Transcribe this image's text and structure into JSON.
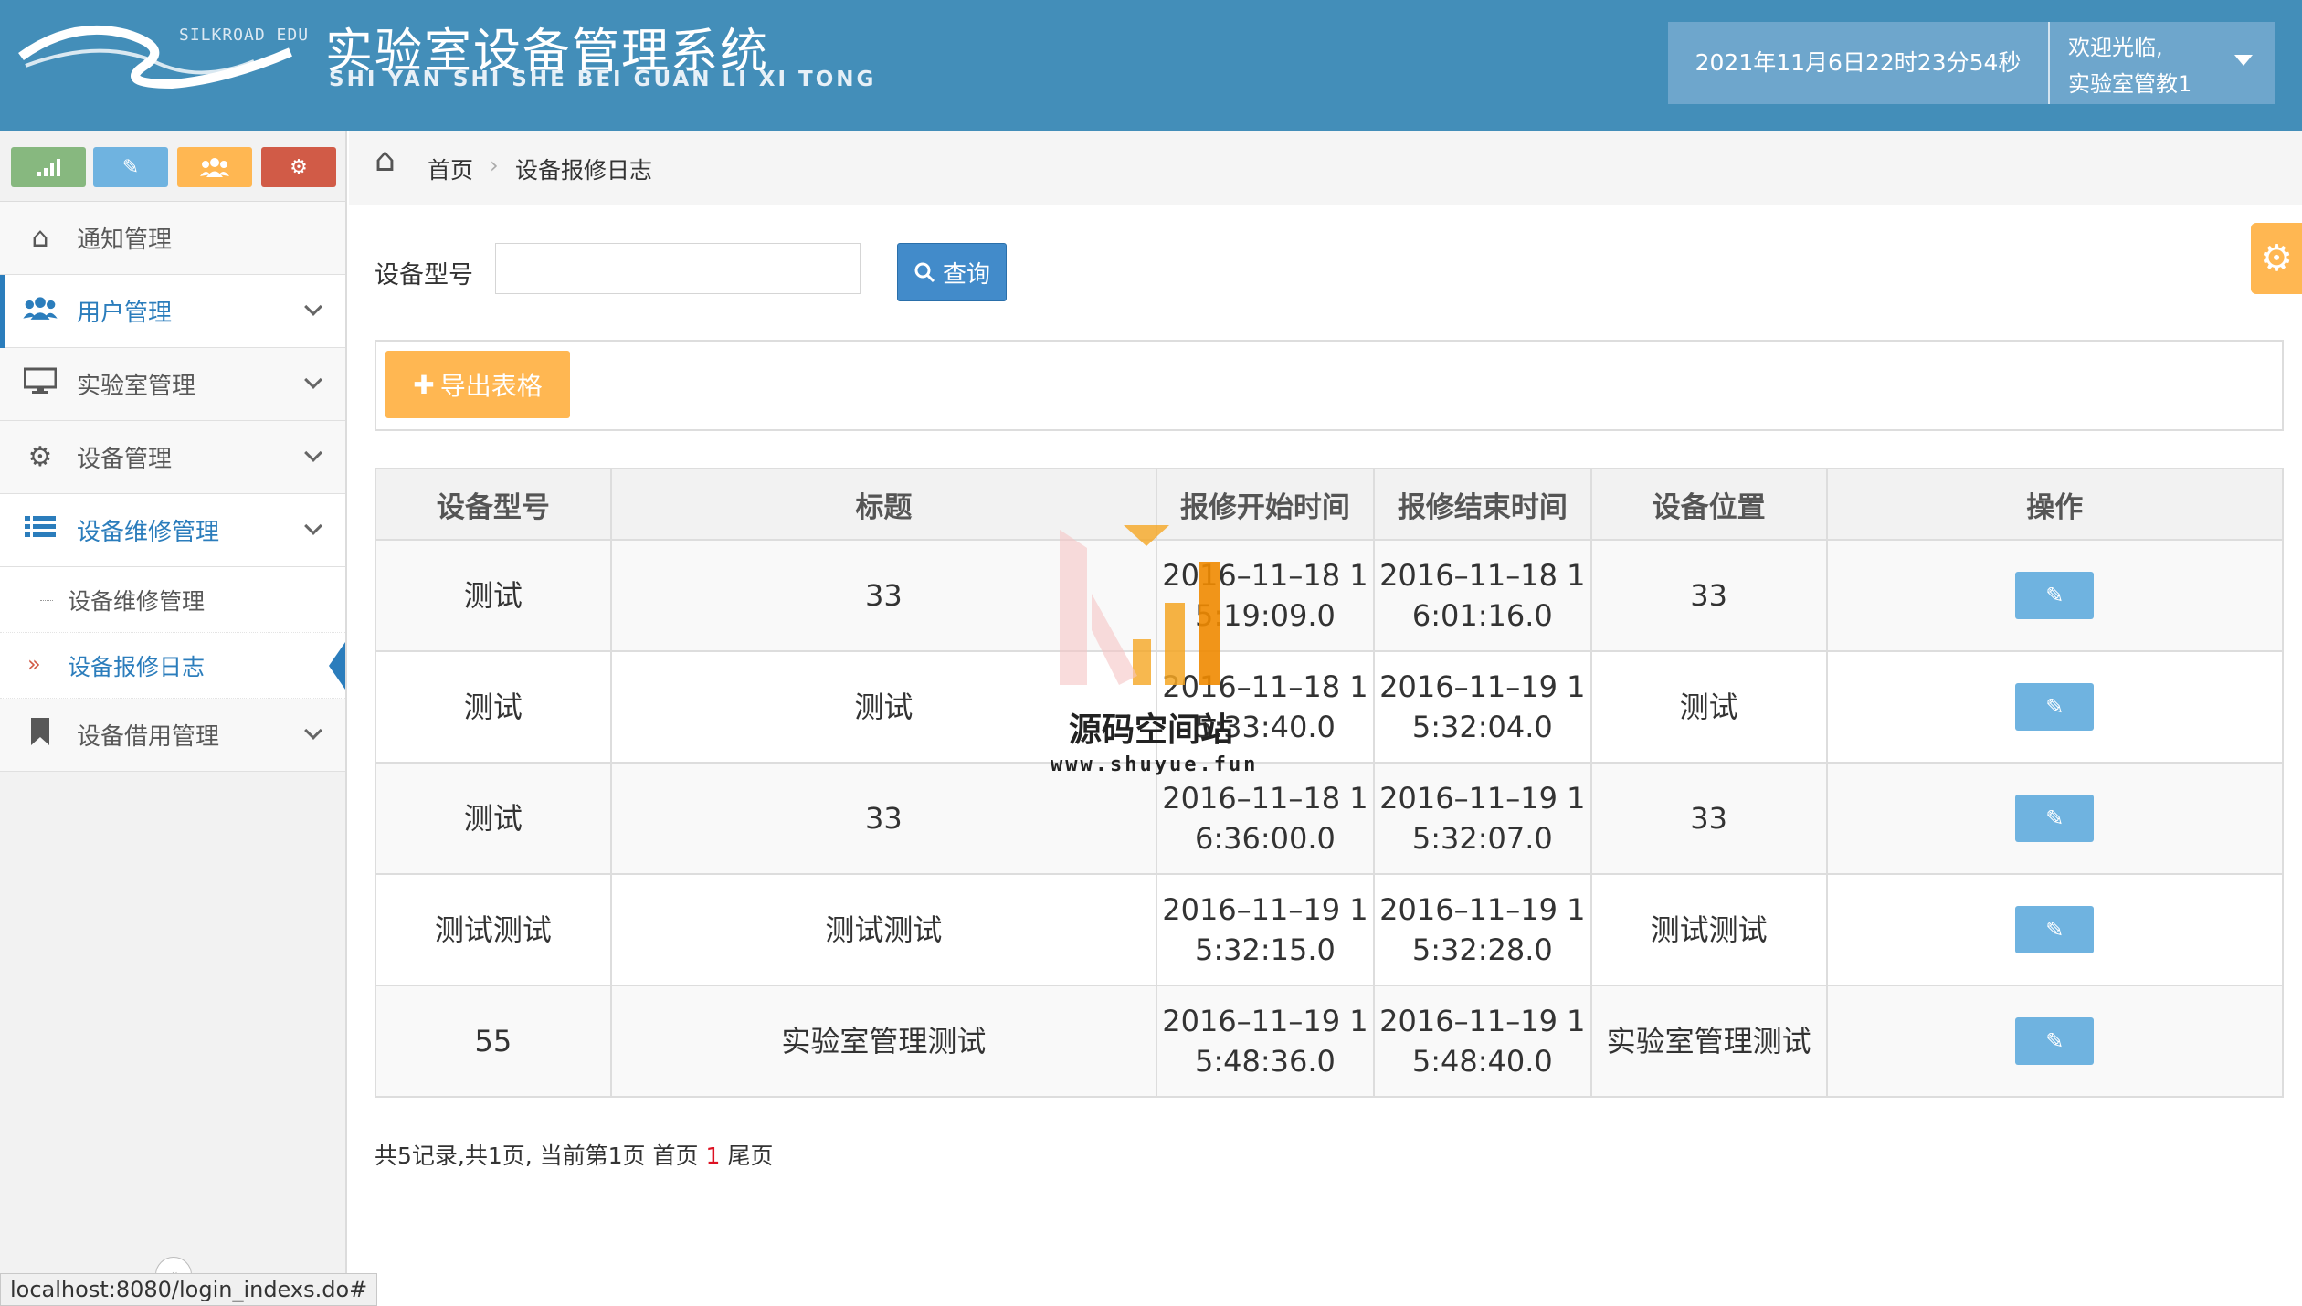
{
  "header": {
    "logo_text": "SILKROAD EDU",
    "title": "实验室设备管理系统",
    "subtitle": "SHI YAN SHI SHE BEI GUAN LI XI TONG",
    "datetime": "2021年11月6日22时23分54秒",
    "welcome": "欢迎光临,",
    "username": "实验室管教1"
  },
  "shortcuts": [
    {
      "name": "chart-icon",
      "color": "#87b87f"
    },
    {
      "name": "pencil-icon",
      "color": "#6fb3e0"
    },
    {
      "name": "users-icon",
      "color": "#ffb752"
    },
    {
      "name": "cogs-icon",
      "color": "#d15b47"
    }
  ],
  "sidebar": {
    "items": [
      {
        "label": "通知管理",
        "icon": "home-icon"
      },
      {
        "label": "用户管理",
        "icon": "users-icon"
      },
      {
        "label": "实验室管理",
        "icon": "desktop-icon"
      },
      {
        "label": "设备管理",
        "icon": "cogs-icon"
      },
      {
        "label": "设备维修管理",
        "icon": "list-icon"
      },
      {
        "label": "设备借用管理",
        "icon": "bookmark-icon"
      }
    ],
    "sub_items": [
      {
        "label": "设备维修管理"
      },
      {
        "label": "设备报修日志",
        "marker": "»"
      }
    ]
  },
  "breadcrumb": {
    "home": "首页",
    "separator": "›",
    "current": "设备报修日志"
  },
  "search": {
    "label": "设备型号",
    "value": "",
    "button_label": "查询"
  },
  "toolbar": {
    "export_label": "导出表格"
  },
  "table": {
    "headers": [
      "设备型号",
      "标题",
      "报修开始时间",
      "报修结束时间",
      "设备位置",
      "操作"
    ],
    "rows": [
      {
        "model": "测试",
        "title": "33",
        "start": "2016–11–18 1\n5:19:09.0",
        "end": "2016–11–18 1\n6:01:16.0",
        "location": "33"
      },
      {
        "model": "测试",
        "title": "测试",
        "start": "2016–11–18 1\n5:33:40.0",
        "end": "2016–11–19 1\n5:32:04.0",
        "location": "测试"
      },
      {
        "model": "测试",
        "title": "33",
        "start": "2016–11–18 1\n6:36:00.0",
        "end": "2016–11–19 1\n5:32:07.0",
        "location": "33"
      },
      {
        "model": "测试测试",
        "title": "测试测试",
        "start": "2016–11–19 1\n5:32:15.0",
        "end": "2016–11–19 1\n5:32:28.0",
        "location": "测试测试"
      },
      {
        "model": "55",
        "title": "实验室管理测试",
        "start": "2016–11–19 1\n5:48:36.0",
        "end": "2016–11–19 1\n5:48:40.0",
        "location": "实验室管理测试"
      }
    ]
  },
  "pagination": {
    "summary": "共5记录,共1页, 当前第1页",
    "first": "首页",
    "current_page": "1",
    "last": "尾页"
  },
  "watermark": {
    "text": "源码空间站",
    "url": "www.shuyue.fun"
  },
  "status_bar": {
    "url": "localhost:8080/login_indexs.do#"
  }
}
